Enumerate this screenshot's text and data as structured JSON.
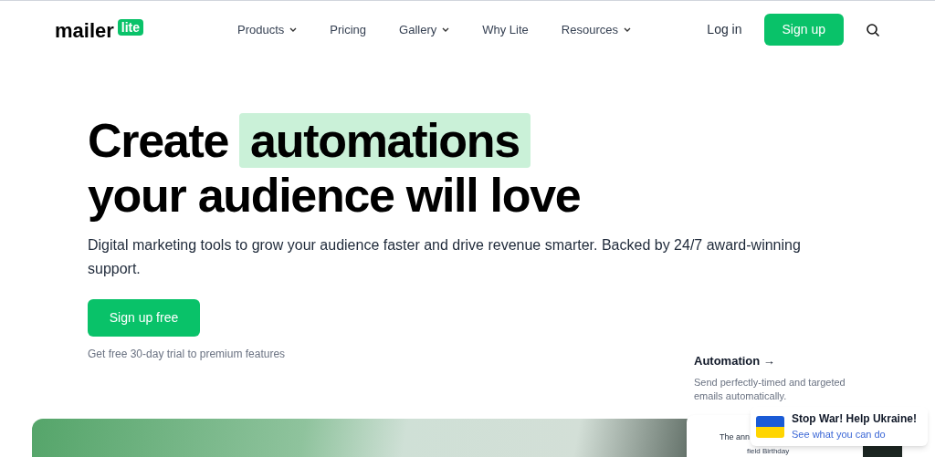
{
  "header": {
    "logo": {
      "word": "mailer",
      "badge": "lite"
    },
    "nav": [
      {
        "label": "Products",
        "dropdown": true
      },
      {
        "label": "Pricing",
        "dropdown": false
      },
      {
        "label": "Gallery",
        "dropdown": true
      },
      {
        "label": "Why Lite",
        "dropdown": false
      },
      {
        "label": "Resources",
        "dropdown": true
      }
    ],
    "login": "Log in",
    "signup": "Sign up"
  },
  "hero": {
    "title_start": "Create",
    "title_highlight": "automations",
    "title_end": "your audience will love",
    "subtitle": "Digital marketing tools to grow your audience faster and drive revenue smarter. Backed by 24/7 award-winning support.",
    "cta": "Sign up free",
    "note": "Get free 30-day trial to premium features"
  },
  "feature": {
    "title": "Automation →",
    "description": "Send perfectly-timed and targeted emails automatically."
  },
  "preview_card": {
    "line_1": "The ann",
    "line_2": "field Birthday"
  },
  "ukraine_banner": {
    "title": "Stop War! Help Ukraine!",
    "link": "See what you can do"
  }
}
